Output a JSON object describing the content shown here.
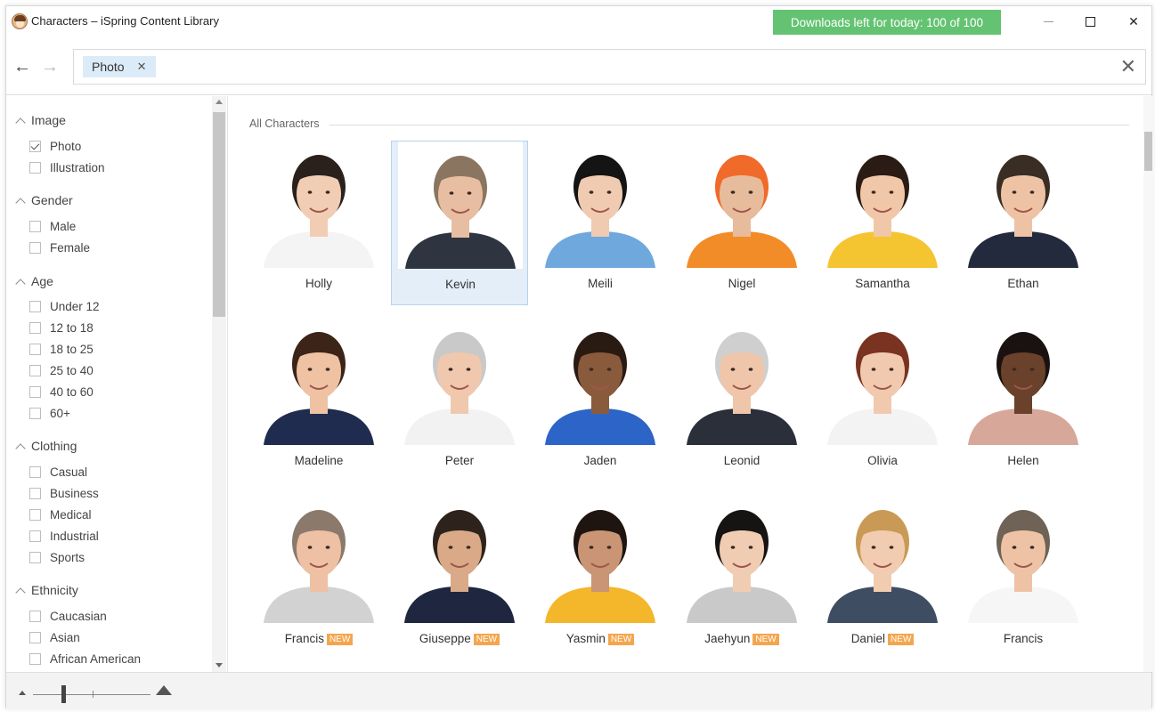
{
  "window": {
    "title": "Characters – iSpring Content Library"
  },
  "downloads": {
    "text": "Downloads left for today: 100 of 100"
  },
  "search": {
    "chip_label": "Photo"
  },
  "filters": {
    "image": {
      "label": "Image",
      "options": [
        {
          "label": "Photo",
          "checked": true
        },
        {
          "label": "Illustration",
          "checked": false
        }
      ]
    },
    "gender": {
      "label": "Gender",
      "options": [
        {
          "label": "Male"
        },
        {
          "label": "Female"
        }
      ]
    },
    "age": {
      "label": "Age",
      "options": [
        {
          "label": "Under 12"
        },
        {
          "label": "12 to 18"
        },
        {
          "label": "18 to 25"
        },
        {
          "label": "25 to 40"
        },
        {
          "label": "40 to 60"
        },
        {
          "label": "60+"
        }
      ]
    },
    "clothing": {
      "label": "Clothing",
      "options": [
        {
          "label": "Casual"
        },
        {
          "label": "Business"
        },
        {
          "label": "Medical"
        },
        {
          "label": "Industrial"
        },
        {
          "label": "Sports"
        }
      ]
    },
    "ethnicity": {
      "label": "Ethnicity",
      "options": [
        {
          "label": "Caucasian"
        },
        {
          "label": "Asian"
        },
        {
          "label": "African American"
        }
      ]
    }
  },
  "section": {
    "title": "All Characters"
  },
  "new_badge": "NEW",
  "characters": [
    {
      "name": "Holly",
      "new": false,
      "selected": false,
      "skin": "#f1cdb3",
      "hair": "#2a211c",
      "shirt": "#f4f4f4"
    },
    {
      "name": "Kevin",
      "new": false,
      "selected": true,
      "skin": "#e8bea2",
      "hair": "#8a7660",
      "shirt": "#2e3440"
    },
    {
      "name": "Meili",
      "new": false,
      "selected": false,
      "skin": "#f0cbb1",
      "hair": "#141414",
      "shirt": "#6fa8dc"
    },
    {
      "name": "Nigel",
      "new": false,
      "selected": false,
      "skin": "#e6bc9c",
      "hair": "#f06a2a",
      "shirt": "#f28c28"
    },
    {
      "name": "Samantha",
      "new": false,
      "selected": false,
      "skin": "#f0c7a8",
      "hair": "#2b1b15",
      "shirt": "#f5c431"
    },
    {
      "name": "Ethan",
      "new": false,
      "selected": false,
      "skin": "#eec3a5",
      "hair": "#3a2d24",
      "shirt": "#232a3d"
    },
    {
      "name": "Madeline",
      "new": false,
      "selected": false,
      "skin": "#eec2a3",
      "hair": "#3c2418",
      "shirt": "#1f2c4f"
    },
    {
      "name": "Peter",
      "new": false,
      "selected": false,
      "skin": "#f0c8ae",
      "hair": "#c9c9c9",
      "shirt": "#f2f2f2"
    },
    {
      "name": "Jaden",
      "new": false,
      "selected": false,
      "skin": "#8a5a3c",
      "hair": "#2a1b12",
      "shirt": "#2c64c8"
    },
    {
      "name": "Leonid",
      "new": false,
      "selected": false,
      "skin": "#efc6a9",
      "hair": "#cfcfcf",
      "shirt": "#2b2f3a"
    },
    {
      "name": "Olivia",
      "new": false,
      "selected": false,
      "skin": "#f1c9ae",
      "hair": "#7a3320",
      "shirt": "#f3f3f3"
    },
    {
      "name": "Helen",
      "new": false,
      "selected": false,
      "skin": "#6a412b",
      "hair": "#1a1210",
      "shirt": "#d7a79a"
    },
    {
      "name": "Francis",
      "new": true,
      "selected": false,
      "skin": "#eec0a4",
      "hair": "#8b7a6c",
      "shirt": "#d2d2d2"
    },
    {
      "name": "Giuseppe",
      "new": true,
      "selected": false,
      "skin": "#d9a988",
      "hair": "#2e231c",
      "shirt": "#1f2740"
    },
    {
      "name": "Yasmin",
      "new": true,
      "selected": false,
      "skin": "#c99575",
      "hair": "#1f1510",
      "shirt": "#f4b62a"
    },
    {
      "name": "Jaehyun",
      "new": true,
      "selected": false,
      "skin": "#f0cdb2",
      "hair": "#161412",
      "shirt": "#c9c9c9"
    },
    {
      "name": "Daniel",
      "new": true,
      "selected": false,
      "skin": "#f2ccb0",
      "hair": "#c89a55",
      "shirt": "#3f4d63"
    },
    {
      "name": "Francis",
      "new": false,
      "selected": false,
      "skin": "#eec3a5",
      "hair": "#6f6256",
      "shirt": "#f6f6f6"
    }
  ]
}
